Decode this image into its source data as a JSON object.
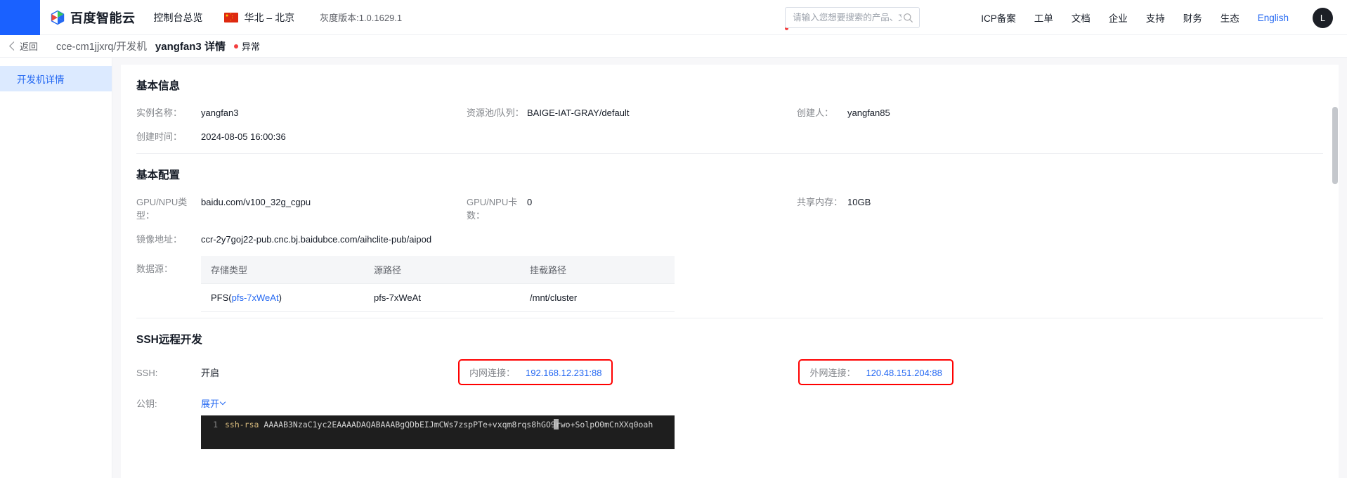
{
  "header": {
    "brand_name": "百度智能云",
    "logo_icon": "baidu-cloud-logo",
    "console_link": "控制台总览",
    "region_flag_icon": "china-flag-icon",
    "region": "华北 – 北京",
    "gray_version": "灰度版本:1.0.1629.1",
    "search": {
      "placeholder": "请输入您想要搜索的产品、文档",
      "value": "",
      "icon": "search-icon"
    },
    "nav": [
      {
        "label": "ICP备案"
      },
      {
        "label": "工单"
      },
      {
        "label": "文档"
      },
      {
        "label": "企业"
      },
      {
        "label": "支持"
      },
      {
        "label": "财务"
      },
      {
        "label": "生态"
      },
      {
        "label": "English"
      }
    ],
    "avatar_letter": "L"
  },
  "breadcrumb": {
    "back_icon": "chevron-left-icon",
    "back_label": "返回",
    "path": "cce-cm1jjxrq/开发机",
    "title": "yangfan3 详情",
    "status_text": "异常",
    "status_color": "#f33e3e"
  },
  "sidebar": {
    "items": [
      {
        "label": "开发机详情",
        "active": true
      }
    ]
  },
  "basic_info": {
    "title": "基本信息",
    "fields": [
      {
        "label": "实例名称：",
        "value": "yangfan3"
      },
      {
        "label": "资源池/队列：",
        "value": "BAIGE-IAT-GRAY/default"
      },
      {
        "label": "创建人：",
        "value": "yangfan85"
      },
      {
        "label": "创建时间：",
        "value": "2024-08-05 16:00:36"
      }
    ]
  },
  "basic_config": {
    "title": "基本配置",
    "fields": [
      {
        "label": "GPU/NPU类型：",
        "value": "baidu.com/v100_32g_cgpu"
      },
      {
        "label": "GPU/NPU卡数：",
        "value": "0"
      },
      {
        "label": "共享内存：",
        "value": "10GB"
      },
      {
        "label": "镜像地址：",
        "value": "ccr-2y7goj22-pub.cnc.bj.baidubce.com/aihclite-pub/aipod"
      }
    ],
    "datasource": {
      "label": "数据源：",
      "columns": [
        "存储类型",
        "源路径",
        "挂载路径"
      ],
      "rows": [
        {
          "type_prefix": "PFS(",
          "type_link": "pfs-7xWeAt",
          "type_suffix": ")",
          "source_path": "pfs-7xWeAt",
          "mount_path": "/mnt/cluster"
        }
      ]
    }
  },
  "ssh_section": {
    "title": "SSH远程开发",
    "ssh_label": "SSH:",
    "ssh_value": "开启",
    "pubkey_label": "公钥:",
    "expand_label": "展开",
    "expand_icon": "chevron-down-icon",
    "internal": {
      "label": "内网连接：",
      "value": "192.168.12.231:88",
      "highlight_color": "#ff0000"
    },
    "external": {
      "label": "外网连接：",
      "value": "120.48.151.204:88",
      "highlight_color": "#ff0000"
    },
    "code": {
      "line_number": "1",
      "keyword": "ssh-rsa",
      "body": " AAAAB3NzaC1yc2EAAAADAQABAAABgQDbEIJmCWs7zspPTe+vxqm8rqs8hGO9rwo+SolpO0mCnXXq0oah"
    }
  },
  "colors": {
    "accent": "#2468f2",
    "brand_blue": "#1a61ff",
    "danger": "#ff0000",
    "sidebar_active_bg": "#dceaff"
  }
}
